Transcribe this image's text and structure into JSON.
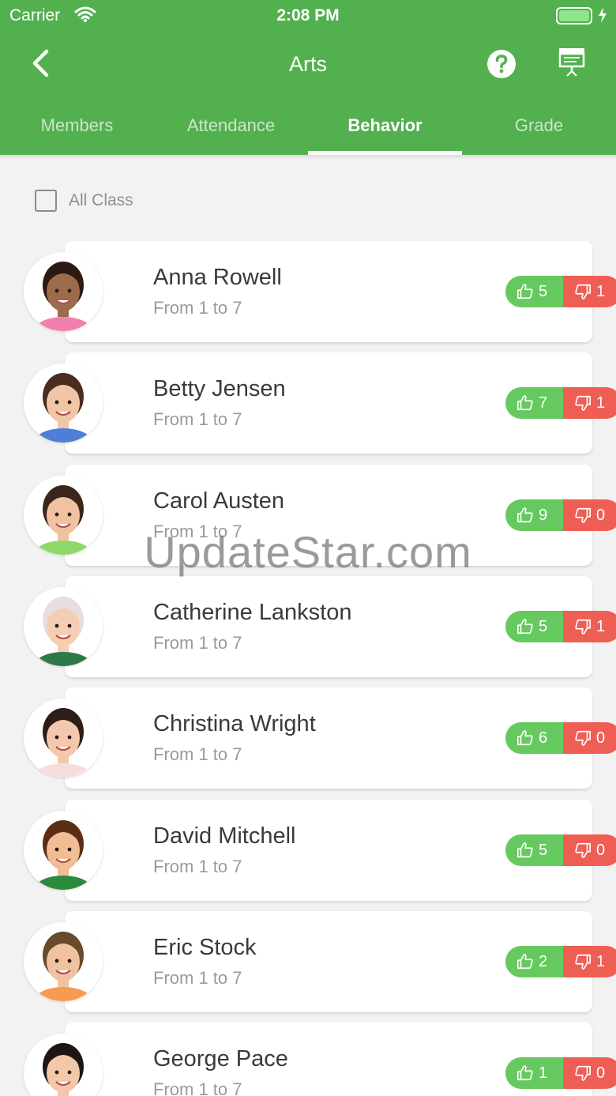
{
  "status_bar": {
    "carrier": "Carrier",
    "time": "2:08 PM"
  },
  "nav": {
    "title": "Arts",
    "back_icon": "chevron-left-icon",
    "help_icon": "help-circle-icon",
    "present_icon": "presentation-board-icon"
  },
  "tabs": [
    {
      "label": "Members",
      "active": false
    },
    {
      "label": "Attendance",
      "active": false
    },
    {
      "label": "Behavior",
      "active": true
    },
    {
      "label": "Grade",
      "active": false
    }
  ],
  "filter": {
    "all_class_label": "All Class",
    "checked": false
  },
  "students": [
    {
      "name": "Anna Rowell",
      "range": "From 1 to 7",
      "likes": "5",
      "dislikes": "1",
      "hair": "#2b1a12",
      "skin": "#9c6b4a",
      "shirt": "#f07fb0"
    },
    {
      "name": "Betty Jensen",
      "range": "From 1 to 7",
      "likes": "7",
      "dislikes": "1",
      "hair": "#4a2d20",
      "skin": "#f1c6a6",
      "shirt": "#4d7fd6"
    },
    {
      "name": "Carol Austen",
      "range": "From 1 to 7",
      "likes": "9",
      "dislikes": "0",
      "hair": "#3b261c",
      "skin": "#f0c2a0",
      "shirt": "#8ed86a"
    },
    {
      "name": "Catherine Lankston",
      "range": "From 1 to 7",
      "likes": "5",
      "dislikes": "1",
      "hair": "#e9dede",
      "skin": "#f4cdb3",
      "shirt": "#2e7a46"
    },
    {
      "name": "Christina Wright",
      "range": "From 1 to 7",
      "likes": "6",
      "dislikes": "0",
      "hair": "#2d1d17",
      "skin": "#f3c8ad",
      "shirt": "#f6dede"
    },
    {
      "name": "David Mitchell",
      "range": "From 1 to 7",
      "likes": "5",
      "dislikes": "0",
      "hair": "#5a2e14",
      "skin": "#f0bd95",
      "shirt": "#2d8a3c"
    },
    {
      "name": "Eric Stock",
      "range": "From 1 to 7",
      "likes": "2",
      "dislikes": "1",
      "hair": "#6a4a2c",
      "skin": "#f0c29f",
      "shirt": "#f79a52"
    },
    {
      "name": "George Pace",
      "range": "From 1 to 7",
      "likes": "1",
      "dislikes": "0",
      "hair": "#1e1612",
      "skin": "#f2c8a8",
      "shirt": "#2c2c2c"
    }
  ],
  "watermark": "UpdateStar.com",
  "colors": {
    "brand_green": "#53b04f",
    "like_green": "#66c95f",
    "dislike_red": "#ef5e54"
  }
}
